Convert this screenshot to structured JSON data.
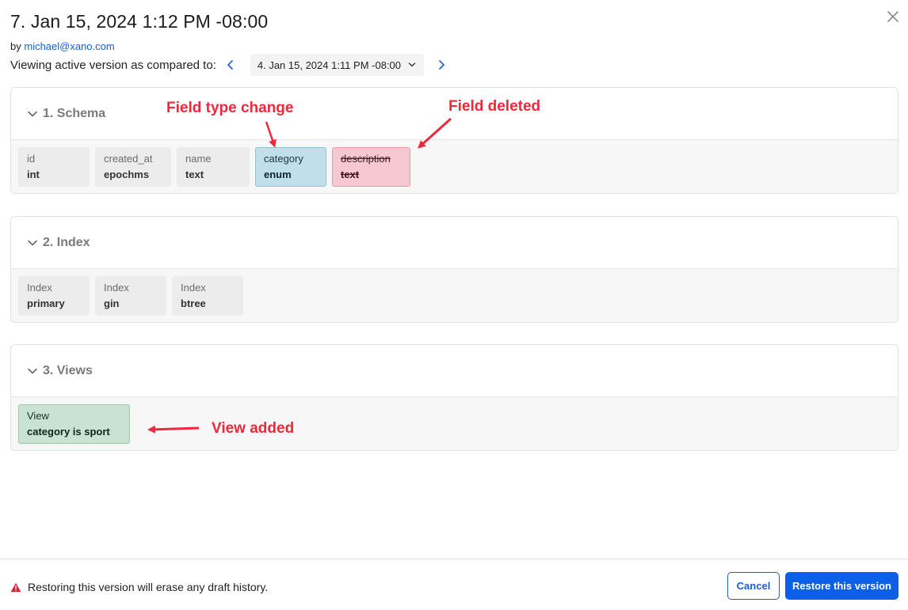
{
  "header": {
    "title": "7. Jan 15, 2024 1:12 PM -08:00",
    "by_prefix": "by",
    "author": "michael@xano.com",
    "compare_label": "Viewing active version as compared to:",
    "compare_selected": "4. Jan 15, 2024 1:11 PM -08:00",
    "icons": [
      "close-icon",
      "chevron-left-icon",
      "chevron-down-icon",
      "chevron-right-icon"
    ]
  },
  "sections": {
    "schema": {
      "title": "1. Schema",
      "fields": [
        {
          "label": "id",
          "value": "int",
          "status": "unchanged"
        },
        {
          "label": "created_at",
          "value": "epochms",
          "status": "unchanged"
        },
        {
          "label": "name",
          "value": "text",
          "status": "unchanged"
        },
        {
          "label": "category",
          "value": "enum",
          "status": "changed"
        },
        {
          "label": "description",
          "value": "text",
          "status": "deleted"
        }
      ]
    },
    "index": {
      "title": "2. Index",
      "items": [
        {
          "label": "Index",
          "value": "primary"
        },
        {
          "label": "Index",
          "value": "gin"
        },
        {
          "label": "Index",
          "value": "btree"
        }
      ]
    },
    "views": {
      "title": "3. Views",
      "items": [
        {
          "label": "View",
          "value": "category is sport",
          "status": "added"
        }
      ]
    }
  },
  "annotations": {
    "field_type_change": "Field type change",
    "field_deleted": "Field deleted",
    "view_added": "View added"
  },
  "footer": {
    "warning": "Restoring this version will erase any draft history.",
    "cancel_label": "Cancel",
    "restore_label": "Restore this version"
  },
  "colors": {
    "accent": "#0b5fe8",
    "changed": "#bfe0eb",
    "deleted": "#f8c8d2",
    "added": "#c8e3d1",
    "annotation": "#f0283c",
    "warning": "#d6223c"
  }
}
